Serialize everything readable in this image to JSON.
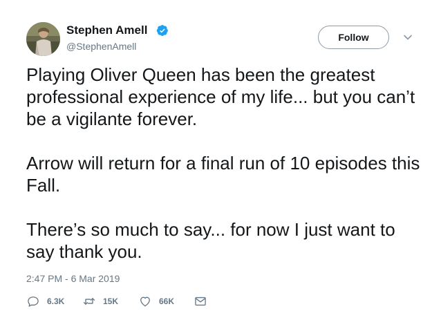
{
  "user": {
    "display_name": "Stephen Amell",
    "handle": "@StephenAmell",
    "verified": true
  },
  "follow_button": {
    "label": "Follow"
  },
  "tweet": {
    "paragraphs": [
      "Playing Oliver Queen has been the greatest professional experience of my life... but you can’t be a vigilante forever.",
      "Arrow will return for a final run of 10 episodes this Fall.",
      "There’s so much to say... for now I just want to say thank you."
    ],
    "timestamp": "2:47 PM - 6 Mar 2019"
  },
  "actions": {
    "replies": "6.3K",
    "retweets": "15K",
    "likes": "66K"
  },
  "icons": {
    "verified": "verified-badge-icon",
    "caret": "chevron-down-icon",
    "reply": "reply-icon",
    "retweet": "retweet-icon",
    "like": "heart-icon",
    "dm": "envelope-icon"
  },
  "colors": {
    "accent": "#1da1f2",
    "text": "#14171a",
    "secondary": "#657786"
  }
}
